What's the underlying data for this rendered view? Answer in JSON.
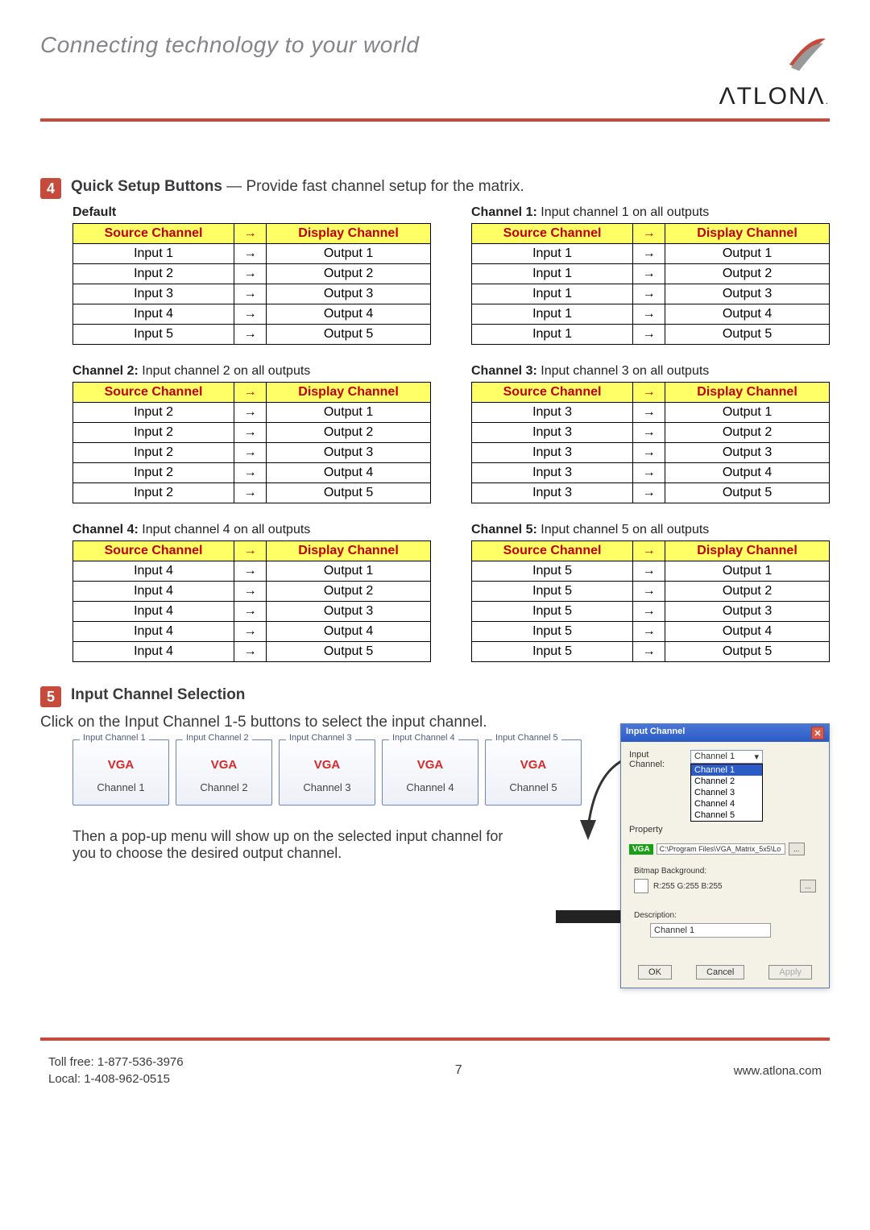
{
  "header": {
    "tagline": "Connecting technology to your world",
    "brand": "ATLONA"
  },
  "section4": {
    "badge": "4",
    "title_bold": "Quick Setup Buttons",
    "title_rest": " — Provide fast channel setup for the matrix.",
    "col_source": "Source Channel",
    "col_arrow": "→",
    "col_display": "Display Channel",
    "tables": [
      {
        "caption_bold": "Default",
        "caption_rest": "",
        "rows": [
          [
            "Input 1",
            "Output 1"
          ],
          [
            "Input 2",
            "Output 2"
          ],
          [
            "Input 3",
            "Output 3"
          ],
          [
            "Input 4",
            "Output 4"
          ],
          [
            "Input 5",
            "Output 5"
          ]
        ]
      },
      {
        "caption_bold": "Channel 1:",
        "caption_rest": " Input channel 1 on all outputs",
        "rows": [
          [
            "Input 1",
            "Output 1"
          ],
          [
            "Input 1",
            "Output 2"
          ],
          [
            "Input 1",
            "Output 3"
          ],
          [
            "Input 1",
            "Output 4"
          ],
          [
            "Input 1",
            "Output 5"
          ]
        ]
      },
      {
        "caption_bold": "Channel 2:",
        "caption_rest": " Input channel 2 on all outputs",
        "rows": [
          [
            "Input 2",
            "Output 1"
          ],
          [
            "Input 2",
            "Output 2"
          ],
          [
            "Input 2",
            "Output 3"
          ],
          [
            "Input 2",
            "Output 4"
          ],
          [
            "Input 2",
            "Output 5"
          ]
        ]
      },
      {
        "caption_bold": "Channel 3:",
        "caption_rest": " Input channel 3 on all outputs",
        "rows": [
          [
            "Input 3",
            "Output 1"
          ],
          [
            "Input 3",
            "Output 2"
          ],
          [
            "Input 3",
            "Output 3"
          ],
          [
            "Input 3",
            "Output 4"
          ],
          [
            "Input 3",
            "Output 5"
          ]
        ]
      },
      {
        "caption_bold": "Channel 4:",
        "caption_rest": " Input channel 4 on all outputs",
        "rows": [
          [
            "Input 4",
            "Output 1"
          ],
          [
            "Input 4",
            "Output 2"
          ],
          [
            "Input 4",
            "Output 3"
          ],
          [
            "Input 4",
            "Output 4"
          ],
          [
            "Input 4",
            "Output 5"
          ]
        ]
      },
      {
        "caption_bold": "Channel 5:",
        "caption_rest": " Input channel 5 on all outputs",
        "rows": [
          [
            "Input 5",
            "Output 1"
          ],
          [
            "Input 5",
            "Output 2"
          ],
          [
            "Input 5",
            "Output 3"
          ],
          [
            "Input 5",
            "Output 4"
          ],
          [
            "Input 5",
            "Output 5"
          ]
        ]
      }
    ]
  },
  "section5": {
    "badge": "5",
    "title": "Input Channel Selection",
    "instruction": "Click on the Input Channel 1-5 buttons to select the input channel.",
    "channels": [
      {
        "legend": "Input Channel 1",
        "type": "VGA",
        "name": "Channel 1"
      },
      {
        "legend": "Input Channel 2",
        "type": "VGA",
        "name": "Channel 2"
      },
      {
        "legend": "Input Channel 3",
        "type": "VGA",
        "name": "Channel 3"
      },
      {
        "legend": "Input Channel 4",
        "type": "VGA",
        "name": "Channel 4"
      },
      {
        "legend": "Input Channel 5",
        "type": "VGA",
        "name": "Channel 5"
      }
    ],
    "followup": "Then a pop-up menu will show up on the selected input channel for you to choose the desired output channel."
  },
  "dialog": {
    "title": "Input Channel",
    "label_input_channel": "Input Channel:",
    "label_property": "Property",
    "combo_value": "Channel 1",
    "options": [
      "Channel 1",
      "Channel 2",
      "Channel 3",
      "Channel 4",
      "Channel 5"
    ],
    "vga_badge": "VGA",
    "path": "C:\\Program Files\\VGA_Matrix_5x5\\Lo",
    "browse": "...",
    "bg_label": "Bitmap Background:",
    "rgb": "R:255  G:255  B:255",
    "desc_label": "Description:",
    "desc_value": "Channel 1",
    "btn_ok": "OK",
    "btn_cancel": "Cancel",
    "btn_apply": "Apply"
  },
  "footer": {
    "tollfree": "Toll free: 1-877-536-3976",
    "local": "Local: 1-408-962-0515",
    "page": "7",
    "url": "www.atlona.com"
  }
}
